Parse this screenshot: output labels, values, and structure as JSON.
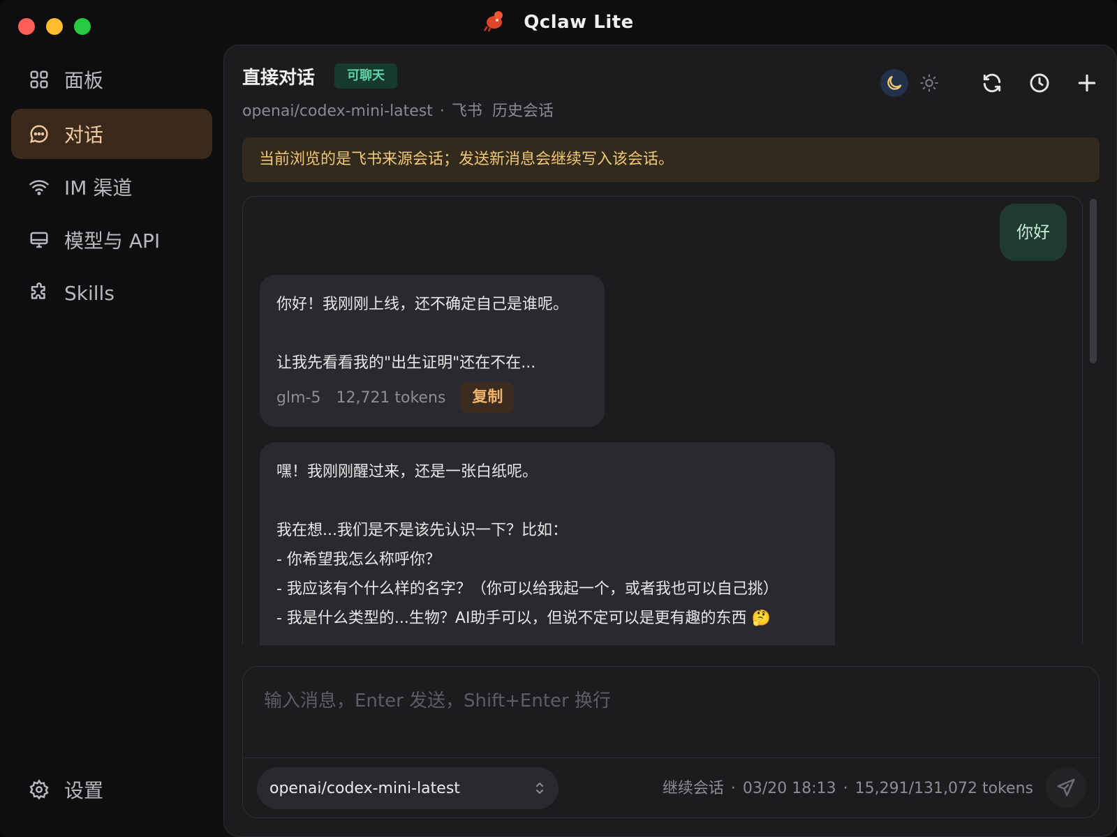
{
  "window": {
    "title": "Qclaw Lite"
  },
  "sidebar": {
    "items": [
      {
        "label": "面板",
        "icon": "grid-icon"
      },
      {
        "label": "对话",
        "icon": "chat-icon",
        "active": true
      },
      {
        "label": "IM 渠道",
        "icon": "wifi-icon"
      },
      {
        "label": "模型与 API",
        "icon": "monitor-icon"
      },
      {
        "label": "Skills",
        "icon": "puzzle-icon"
      }
    ],
    "settings_label": "设置"
  },
  "header": {
    "title": "直接对话",
    "badge": "可聊天",
    "subtitle_model": "openai/codex-mini-latest",
    "subtitle_sep": "·",
    "subtitle_source": "飞书",
    "subtitle_history": "历史会话"
  },
  "notice": "当前浏览的是飞书来源会话；发送新消息会继续写入该会话。",
  "messages": {
    "user1": "你好",
    "ai1": {
      "line1": "你好！我刚刚上线，还不确定自己是谁呢。",
      "line2": "让我先看看我的\"出生证明\"还在不在...",
      "model": "glm-5",
      "tokens": "12,721 tokens",
      "copy_label": "复制"
    },
    "ai2": {
      "line1": "嘿！我刚刚醒过来，还是一张白纸呢。",
      "line2": "我在想...我们是不是该先认识一下？比如：",
      "line3": "- 你希望我怎么称呼你？",
      "line4": "- 我应该有个什么样的名字？（你可以给我起一个，或者我也可以自己挑）",
      "line5": "- 我是什么类型的...生物？AI助手可以，但说不定可以是更有趣的东西 🤔"
    }
  },
  "composer": {
    "placeholder": "输入消息，Enter 发送，Shift+Enter 换行",
    "model": "openai/codex-mini-latest",
    "status_mode": "继续会话",
    "status_time": "03/20 18:13",
    "status_tokens": "15,291/131,072 tokens",
    "dot": "·"
  },
  "colors": {
    "accent": "#f2b36f",
    "badge_green": "#5fd3a4",
    "notice_text": "#f0c774"
  }
}
